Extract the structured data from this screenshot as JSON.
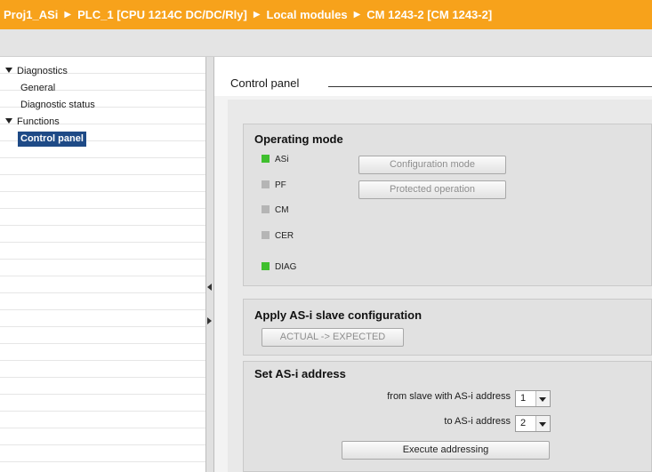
{
  "titlebar": {
    "crumbs": [
      "Proj1_ASi",
      "PLC_1 [CPU 1214C DC/DC/Rly]",
      "Local modules",
      "CM 1243-2 [CM 1243-2]"
    ],
    "separator": "▶"
  },
  "nav": {
    "diagnostics": "Diagnostics",
    "general": "General",
    "diagnostic_status": "Diagnostic status",
    "functions": "Functions",
    "control_panel": "Control panel"
  },
  "main": {
    "title": "Control panel",
    "operating_mode": {
      "title": "Operating mode",
      "leds": [
        {
          "label": "ASi",
          "color": "#3fbf2e"
        },
        {
          "label": "PF",
          "color": "#b5b5b5"
        },
        {
          "label": "CM",
          "color": "#b5b5b5"
        },
        {
          "label": "CER",
          "color": "#b5b5b5"
        },
        {
          "label": "DIAG",
          "color": "#3fbf2e"
        }
      ],
      "configuration_mode": "Configuration mode",
      "protected_operation": "Protected operation"
    },
    "apply_config": {
      "title": "Apply AS-i slave configuration",
      "button": "ACTUAL -> EXPECTED"
    },
    "set_address": {
      "title": "Set AS-i address",
      "from_label": "from slave with AS-i address",
      "from_value": "1",
      "to_label": "to AS-i address",
      "to_value": "2",
      "execute": "Execute addressing"
    }
  },
  "colors": {
    "titlebar": "#f7a21b",
    "selection": "#1e4a86",
    "led_on": "#3fbf2e",
    "led_off": "#b5b5b5"
  }
}
